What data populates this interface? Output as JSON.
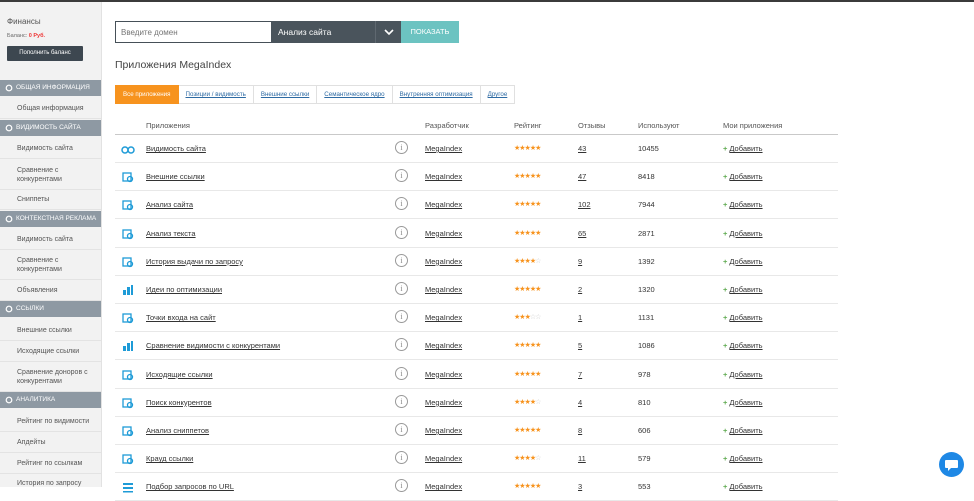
{
  "sidebar": {
    "finance_title": "Финансы",
    "balance_label": "Баланс:",
    "balance_amount": "0 Руб.",
    "topup_label": "Пополнить баланс",
    "sections": [
      {
        "label": "Общая информация",
        "items": [
          "Общая информация"
        ]
      },
      {
        "label": "Видимость сайта",
        "items": [
          "Видимость сайта",
          "Сравнение с конкурентами",
          "Сниппеты"
        ]
      },
      {
        "label": "Контекстная реклама",
        "items": [
          "Видимость сайта",
          "Сравнение с конкурентами",
          "Объявления"
        ]
      },
      {
        "label": "Ссылки",
        "items": [
          "Внешние ссылки",
          "Исходящие ссылки",
          "Сравнение доноров с конкурентами"
        ]
      },
      {
        "label": "Аналитика",
        "items": [
          "Рейтинг по видимости",
          "Апдейты",
          "Рейтинг по ссылкам",
          "История по запросу"
        ]
      }
    ]
  },
  "search": {
    "placeholder": "Введите домен",
    "select_value": "Анализ сайта",
    "button_label": "ПОКАЗАТЬ"
  },
  "page_title": "Приложения MegaIndex",
  "tabs": [
    "Все приложения",
    "Позиции / видимость",
    "Внешние ссылки",
    "Семантическое ядро",
    "Внутренняя оптимизация",
    "Другое"
  ],
  "table": {
    "headers": {
      "app": "Приложения",
      "developer": "Разработчик",
      "rating": "Рейтинг",
      "reviews": "Отзывы",
      "uses": "Используют",
      "my": "Мои приложения"
    },
    "add_label": "Добавить",
    "rows": [
      {
        "icon": "binoculars-icon",
        "name": "Видимость сайта",
        "developer": "MegaIndex",
        "rating": 4.5,
        "reviews": "43",
        "uses": "10455"
      },
      {
        "icon": "external-link-icon",
        "name": "Внешние ссылки",
        "developer": "MegaIndex",
        "rating": 5,
        "reviews": "47",
        "uses": "8418"
      },
      {
        "icon": "site-analysis-icon",
        "name": "Анализ сайта",
        "developer": "MegaIndex",
        "rating": 5,
        "reviews": "102",
        "uses": "7944"
      },
      {
        "icon": "text-analysis-icon",
        "name": "Анализ текста",
        "developer": "MegaIndex",
        "rating": 5,
        "reviews": "65",
        "uses": "2871"
      },
      {
        "icon": "history-icon",
        "name": "История выдачи по запросу",
        "developer": "MegaIndex",
        "rating": 4,
        "reviews": "9",
        "uses": "1392"
      },
      {
        "icon": "bar-chart-icon",
        "name": "Идеи по оптимизации",
        "developer": "MegaIndex",
        "rating": 5,
        "reviews": "2",
        "uses": "1320"
      },
      {
        "icon": "entry-points-icon",
        "name": "Точки входа на сайт",
        "developer": "MegaIndex",
        "rating": 2.5,
        "reviews": "1",
        "uses": "1131"
      },
      {
        "icon": "bar-chart-icon",
        "name": "Сравнение видимости с конкурентами",
        "developer": "MegaIndex",
        "rating": 5,
        "reviews": "5",
        "uses": "1086"
      },
      {
        "icon": "outgoing-link-icon",
        "name": "Исходящие ссылки",
        "developer": "MegaIndex",
        "rating": 4.5,
        "reviews": "7",
        "uses": "978"
      },
      {
        "icon": "search-competitors-icon",
        "name": "Поиск конкурентов",
        "developer": "MegaIndex",
        "rating": 4,
        "reviews": "4",
        "uses": "810"
      },
      {
        "icon": "snippet-analysis-icon",
        "name": "Анализ сниппетов",
        "developer": "MegaIndex",
        "rating": 4.5,
        "reviews": "8",
        "uses": "606"
      },
      {
        "icon": "external-link-icon",
        "name": "Крауд ссылки",
        "developer": "MegaIndex",
        "rating": 4,
        "reviews": "11",
        "uses": "579"
      },
      {
        "icon": "list-icon",
        "name": "Подбор запросов по URL",
        "developer": "MegaIndex",
        "rating": 4.5,
        "reviews": "3",
        "uses": "553"
      }
    ]
  },
  "colors": {
    "accent": "#f7931e",
    "teal": "#6cc3c1",
    "dark": "#4a545c",
    "sidebar_section": "#8e99a3",
    "add_plus": "#5aa84b",
    "icon": "#1e9bd7"
  }
}
